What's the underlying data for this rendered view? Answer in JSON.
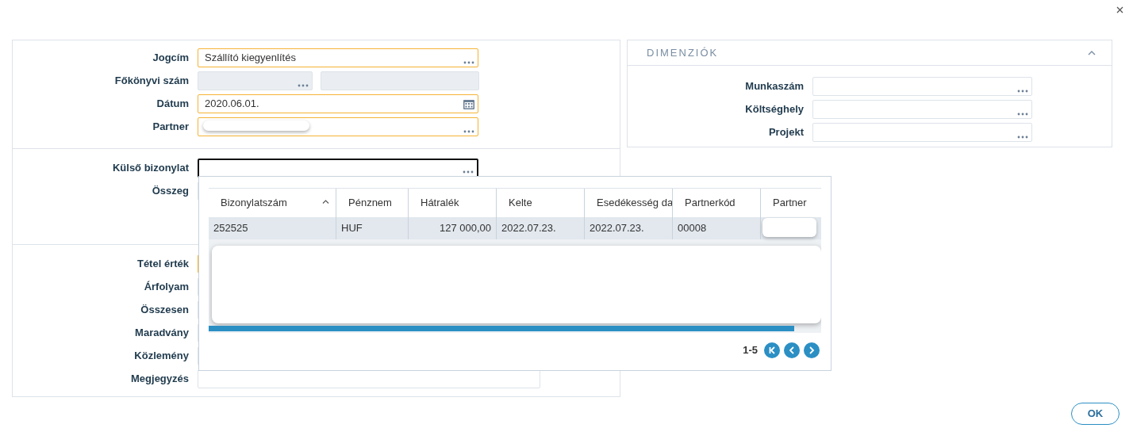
{
  "form": {
    "sections": [
      {
        "fields": [
          {
            "label": "Jogcím",
            "kind": "lookup",
            "required": true,
            "disabled": false,
            "value": "Szállító kiegyenlítés"
          },
          {
            "label": "Főkönyvi szám",
            "kind": "lookup_pair",
            "required": false,
            "disabled": true
          },
          {
            "label": "Dátum",
            "kind": "date",
            "required": true,
            "disabled": false,
            "value": "2020.06.01."
          },
          {
            "label": "Partner",
            "kind": "lookup_redacted",
            "required": true,
            "disabled": false
          }
        ]
      },
      {
        "fields": [
          {
            "label": "Külső bizonylat",
            "kind": "lookup",
            "focused": true
          },
          {
            "label": "Összeg",
            "kind": "text"
          }
        ]
      },
      {
        "fields": [
          {
            "label": "Tétel érték",
            "kind": "text",
            "required": true
          },
          {
            "label": "Árfolyam",
            "kind": "text"
          },
          {
            "label": "Összesen",
            "kind": "text"
          },
          {
            "label": "Maradvány",
            "kind": "text"
          },
          {
            "label": "Közlemény",
            "kind": "text"
          },
          {
            "label": "Megjegyzés",
            "kind": "text"
          }
        ]
      }
    ]
  },
  "dimensions": {
    "title": "DIMENZIÓK",
    "expanded": true,
    "fields": [
      {
        "label": "Munkaszám",
        "kind": "lookup"
      },
      {
        "label": "Költséghely",
        "kind": "lookup"
      },
      {
        "label": "Projekt",
        "kind": "lookup"
      }
    ]
  },
  "lookup_popup": {
    "columns": [
      {
        "label": "Bizonylatszám",
        "sorted": true
      },
      {
        "label": "Pénznem",
        "sorted": false
      },
      {
        "label": "Hátralék",
        "sorted": false
      },
      {
        "label": "Kelte",
        "sorted": false
      },
      {
        "label": "Esedékesség da",
        "sorted": false
      },
      {
        "label": "Partnerkód",
        "sorted": false
      },
      {
        "label": "Partner",
        "sorted": false
      }
    ],
    "rows": [
      {
        "selected": true,
        "cells": [
          "252525",
          "HUF",
          "127 000,00",
          "2022.07.23.",
          "2022.07.23.",
          "00008"
        ]
      }
    ],
    "page_range": "1-5"
  },
  "buttons": [
    "OK"
  ]
}
